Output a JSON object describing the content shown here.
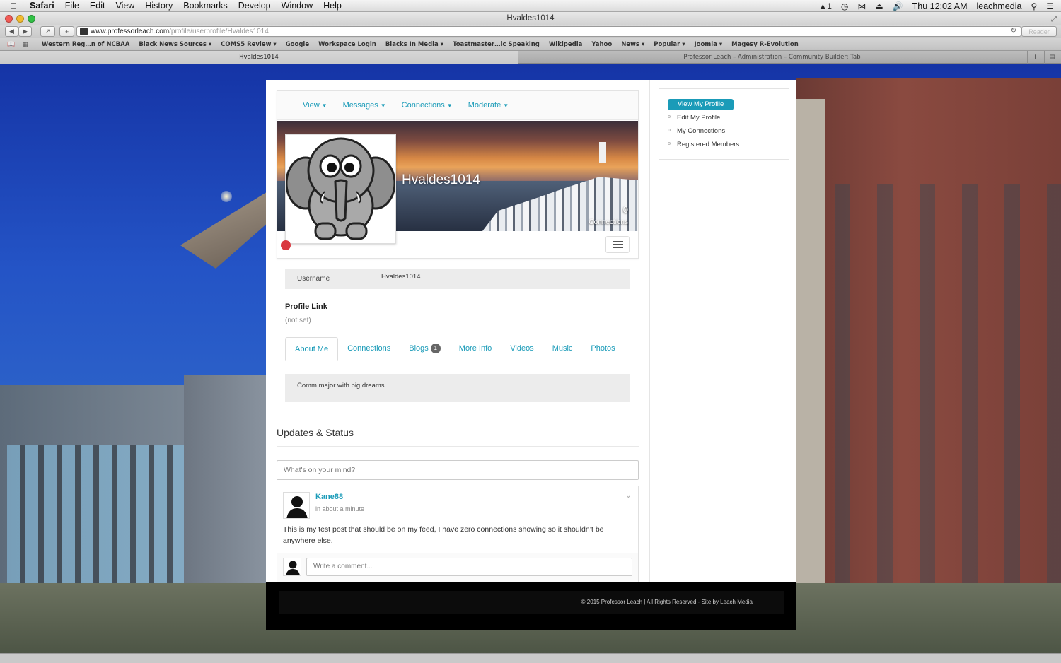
{
  "menubar": {
    "app": "Safari",
    "items": [
      "File",
      "Edit",
      "View",
      "History",
      "Bookmarks",
      "Develop",
      "Window",
      "Help"
    ],
    "status_badge": "1",
    "clock": "Thu 12:02 AM",
    "user": "leachmedia"
  },
  "window": {
    "title": "Hvaldes1014"
  },
  "toolbar": {
    "url_host": "www.professorleach.com",
    "url_path": "/profile/userprofile/Hvaldes1014",
    "reader_label": "Reader"
  },
  "bookmarks": [
    "Western Reg…n of NCBAA",
    "Black News Sources ▾",
    "COMS5 Review ▾",
    "Google",
    "Workspace Login",
    "Blacks In Media ▾",
    "Toastmaster…ic Speaking",
    "Wikipedia",
    "Yahoo",
    "News ▾",
    "Popular ▾",
    "Joomla ▾",
    "Magesy R-Evolution"
  ],
  "tabs": {
    "active": "Hvaldes1014",
    "inactive": "Professor Leach – Administration – Community Builder: Tab"
  },
  "profile_nav": [
    "View",
    "Messages",
    "Connections",
    "Moderate"
  ],
  "profile": {
    "display_name": "Hvaldes1014",
    "connections_count": "0",
    "connections_label": "Connections",
    "username_label": "Username",
    "username_value": "Hvaldes1014",
    "profile_link_title": "Profile Link",
    "profile_link_value": "(not set)",
    "status_color": "#d9383f"
  },
  "profile_tabs": [
    {
      "label": "About Me",
      "active": true
    },
    {
      "label": "Connections"
    },
    {
      "label": "Blogs",
      "badge": "1"
    },
    {
      "label": "More Info"
    },
    {
      "label": "Videos"
    },
    {
      "label": "Music"
    },
    {
      "label": "Photos"
    }
  ],
  "about_me": "Comm major with big dreams",
  "updates": {
    "title": "Updates & Status",
    "placeholder": "What's on your mind?",
    "post": {
      "author": "Kane88",
      "time": "in about a minute",
      "text": "This is my test post that should be on my feed, I have zero connections showing so it shouldn’t be anywhere else.",
      "comment_placeholder": "Write a comment..."
    }
  },
  "sidebar": {
    "active": "View My Profile",
    "items": [
      "Edit My Profile",
      "My Connections",
      "Registered Members"
    ]
  },
  "footer": {
    "text": "© 2015 Professor Leach | All Rights Reserved - Site by Leach Media"
  },
  "colors": {
    "accent": "#1a9bb8",
    "footer_bg": "#000000"
  }
}
